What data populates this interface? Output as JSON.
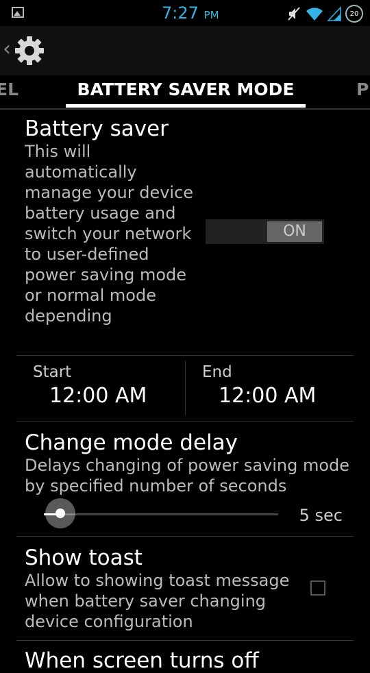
{
  "status_bar": {
    "time": "7:27",
    "ampm": "PM",
    "battery_level": "20",
    "icons": [
      "image-notification-icon",
      "mute-icon",
      "wifi-icon",
      "signal-icon",
      "battery-icon"
    ],
    "time_color": "#33b5e5"
  },
  "action_bar": {
    "icons": [
      "back-chevron-icon",
      "settings-gear-icon"
    ]
  },
  "tabs": {
    "left_partial": "EL",
    "active": "BATTERY SAVER MODE",
    "right_partial": "PI"
  },
  "battery_saver": {
    "title": "Battery saver",
    "description": "This will automatically manage your device battery usage and switch your network to user-defined power saving mode or normal mode depending",
    "toggle_label": "ON"
  },
  "schedule": {
    "start_label": "Start",
    "start_value": "12:00 AM",
    "end_label": "End",
    "end_value": "12:00 AM"
  },
  "change_mode_delay": {
    "title": "Change mode delay",
    "description": "Delays changing of power saving mode by specified number of seconds",
    "slider_value_label": "5 sec",
    "slider_fraction": 0.07
  },
  "show_toast": {
    "title": "Show toast",
    "description": "Allow to showing toast message when battery saver changing device configuration",
    "checked": false
  },
  "next_item": {
    "title_partial": "When screen turns off"
  }
}
